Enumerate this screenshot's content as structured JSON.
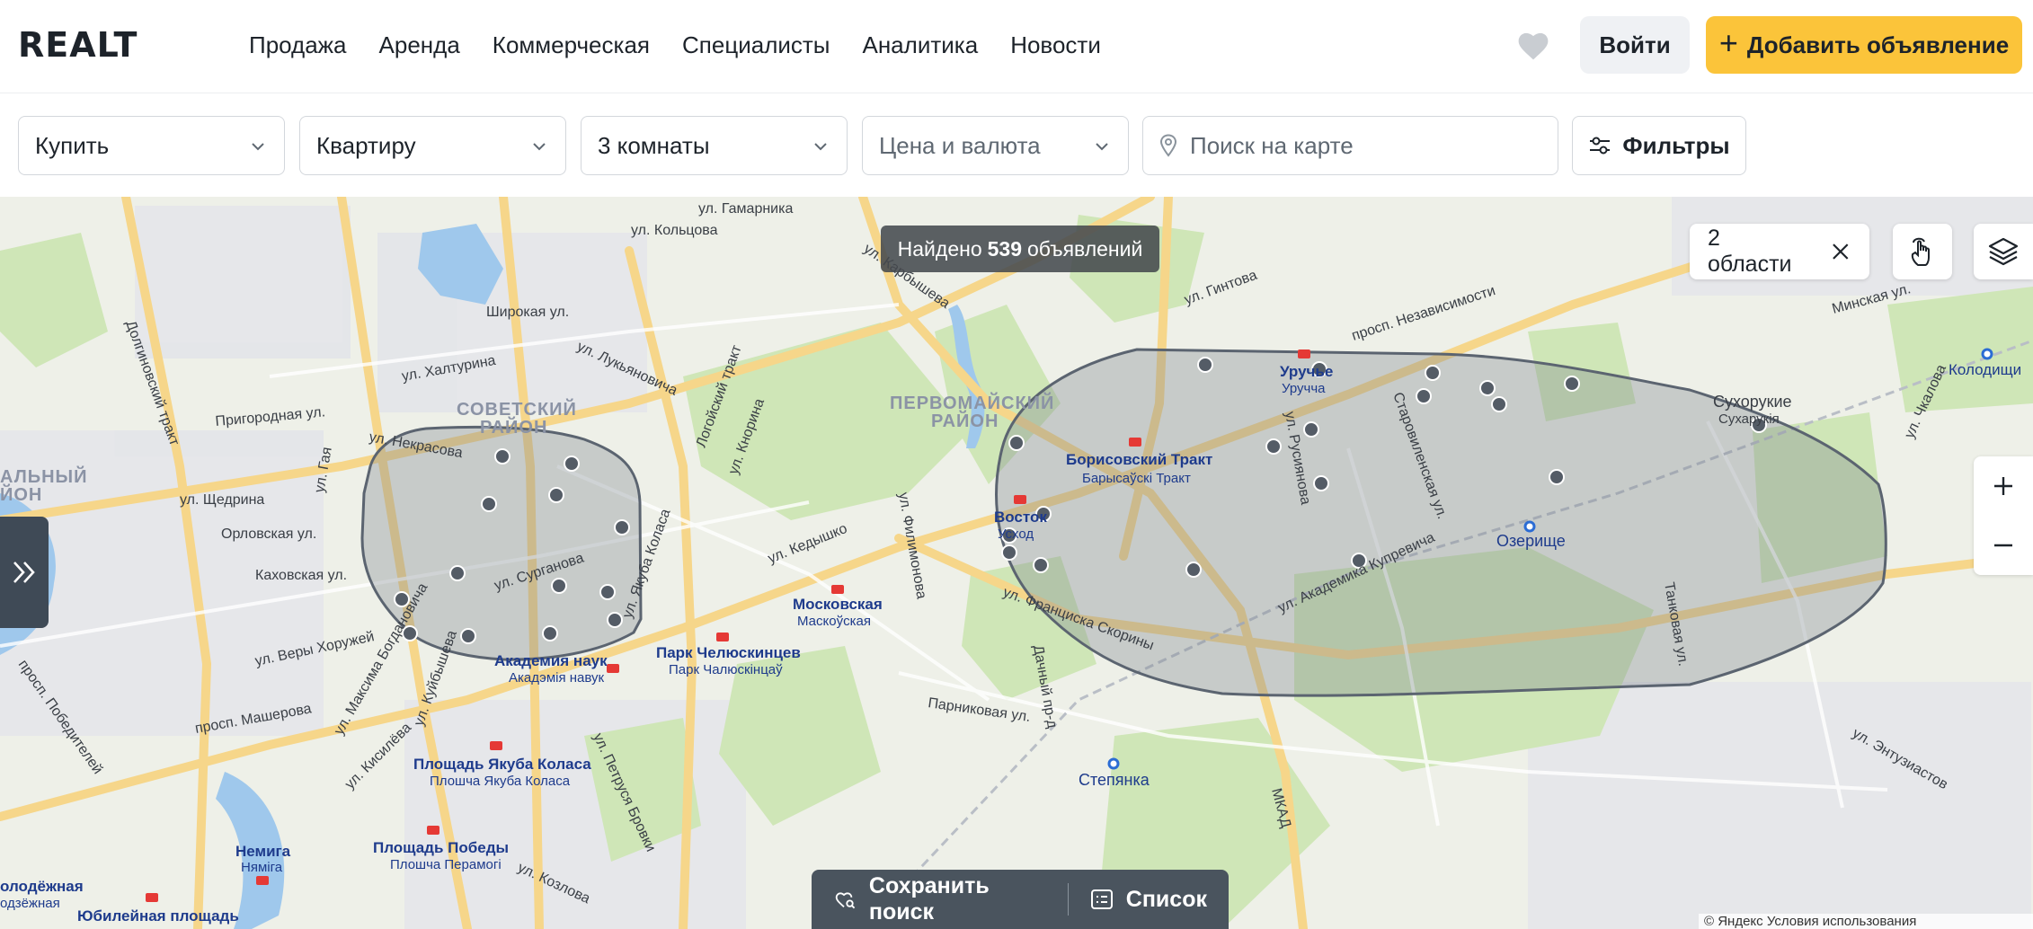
{
  "header": {
    "logo": "REALT",
    "nav": [
      "Продажа",
      "Аренда",
      "Коммерческая",
      "Специалисты",
      "Аналитика",
      "Новости"
    ],
    "login_label": "Войти",
    "add_label": "Добавить объявление"
  },
  "filters": {
    "deal_type": "Купить",
    "property_type": "Квартиру",
    "rooms": "3 комнаты",
    "price_placeholder": "Цена и валюта",
    "map_search_placeholder": "Поиск на карте",
    "filters_label": "Фильтры"
  },
  "map": {
    "found_prefix": "Найдено",
    "found_count": "539",
    "found_suffix": "объявлений",
    "areas_label": "2 области",
    "save_search_label": "Сохранить поиск",
    "list_label": "Список",
    "copyright": "© Яндекс Условия использования",
    "districts": [
      "СОВЕТСКИЙ",
      "РАЙОН",
      "ПЕРВОМАЙСКИЙ",
      "РАЙОН",
      "АЛЬНЫЙ",
      "ЙОН"
    ],
    "streets": [
      "ул. Гамарника",
      "ул. Кольцова",
      "ул. Карбышева",
      "ул. Гинтова",
      "просп. Независимости",
      "Широкая ул.",
      "ул. Халтурина",
      "ул. Лукьяновича",
      "Логойский тракт",
      "Долгиновский тракт",
      "Пригородная ул.",
      "ул. Некрасова",
      "ул. Щедрина",
      "Орловская ул.",
      "Каховская ул.",
      "ул. Сурганова",
      "ул. Веры Хоружей",
      "ул. Якуба Коласа",
      "ул. Кедышко",
      "ул. Филимонова",
      "ул. Франциска Скорины",
      "ул. Академика Купревича",
      "Парниковая ул.",
      "просп. Машерова",
      "ул. Козлова",
      "МКАД",
      "Танковая ул.",
      "ул. Чкалова",
      "Минская ул.",
      "Старовиленская ул.",
      "ул. Русиянова",
      "просп. Победителей",
      "ул. Максима Богдановича",
      "ул. Куйбышева",
      "ул. Петруся Бровки",
      "Дачный пр-д",
      "ул. Энтузиастов",
      "ул. Кисилёва",
      "ул. Кнорина",
      "ул. Гая"
    ],
    "places": [
      {
        "name": "Борисовский Тракт",
        "sub": "Барысаўскі Тракт"
      },
      {
        "name": "Уручье",
        "sub": "Уручча"
      },
      {
        "name": "Московская",
        "sub": "Маскоўская"
      },
      {
        "name": "Парк Челюскинцев",
        "sub": "Парк Чалюскінцаў"
      },
      {
        "name": "Академия наук",
        "sub": "Акадэмія навук"
      },
      {
        "name": "Площадь Якуба Коласа",
        "sub": "Плошча Якуба Коласа"
      },
      {
        "name": "Площадь Победы",
        "sub": "Плошча Перамогі"
      },
      {
        "name": "Немига",
        "sub": "Няміга"
      },
      {
        "name": "Восток",
        "sub": "Усход"
      },
      {
        "name": "Сухорукие",
        "sub": "Сухарукія"
      },
      {
        "name": "Озерище",
        "sub": ""
      },
      {
        "name": "Степянка",
        "sub": ""
      },
      {
        "name": "Колодищи",
        "sub": ""
      },
      {
        "name": "Юбилейная площадь",
        "sub": ""
      },
      {
        "name": "олодёжная",
        "sub": "одзёжная"
      }
    ],
    "colors": {
      "polygon_stroke": "#5b6470",
      "polygon_fill": "#7f868f",
      "accent": "#fbc43a",
      "metro": "#e53935"
    }
  }
}
